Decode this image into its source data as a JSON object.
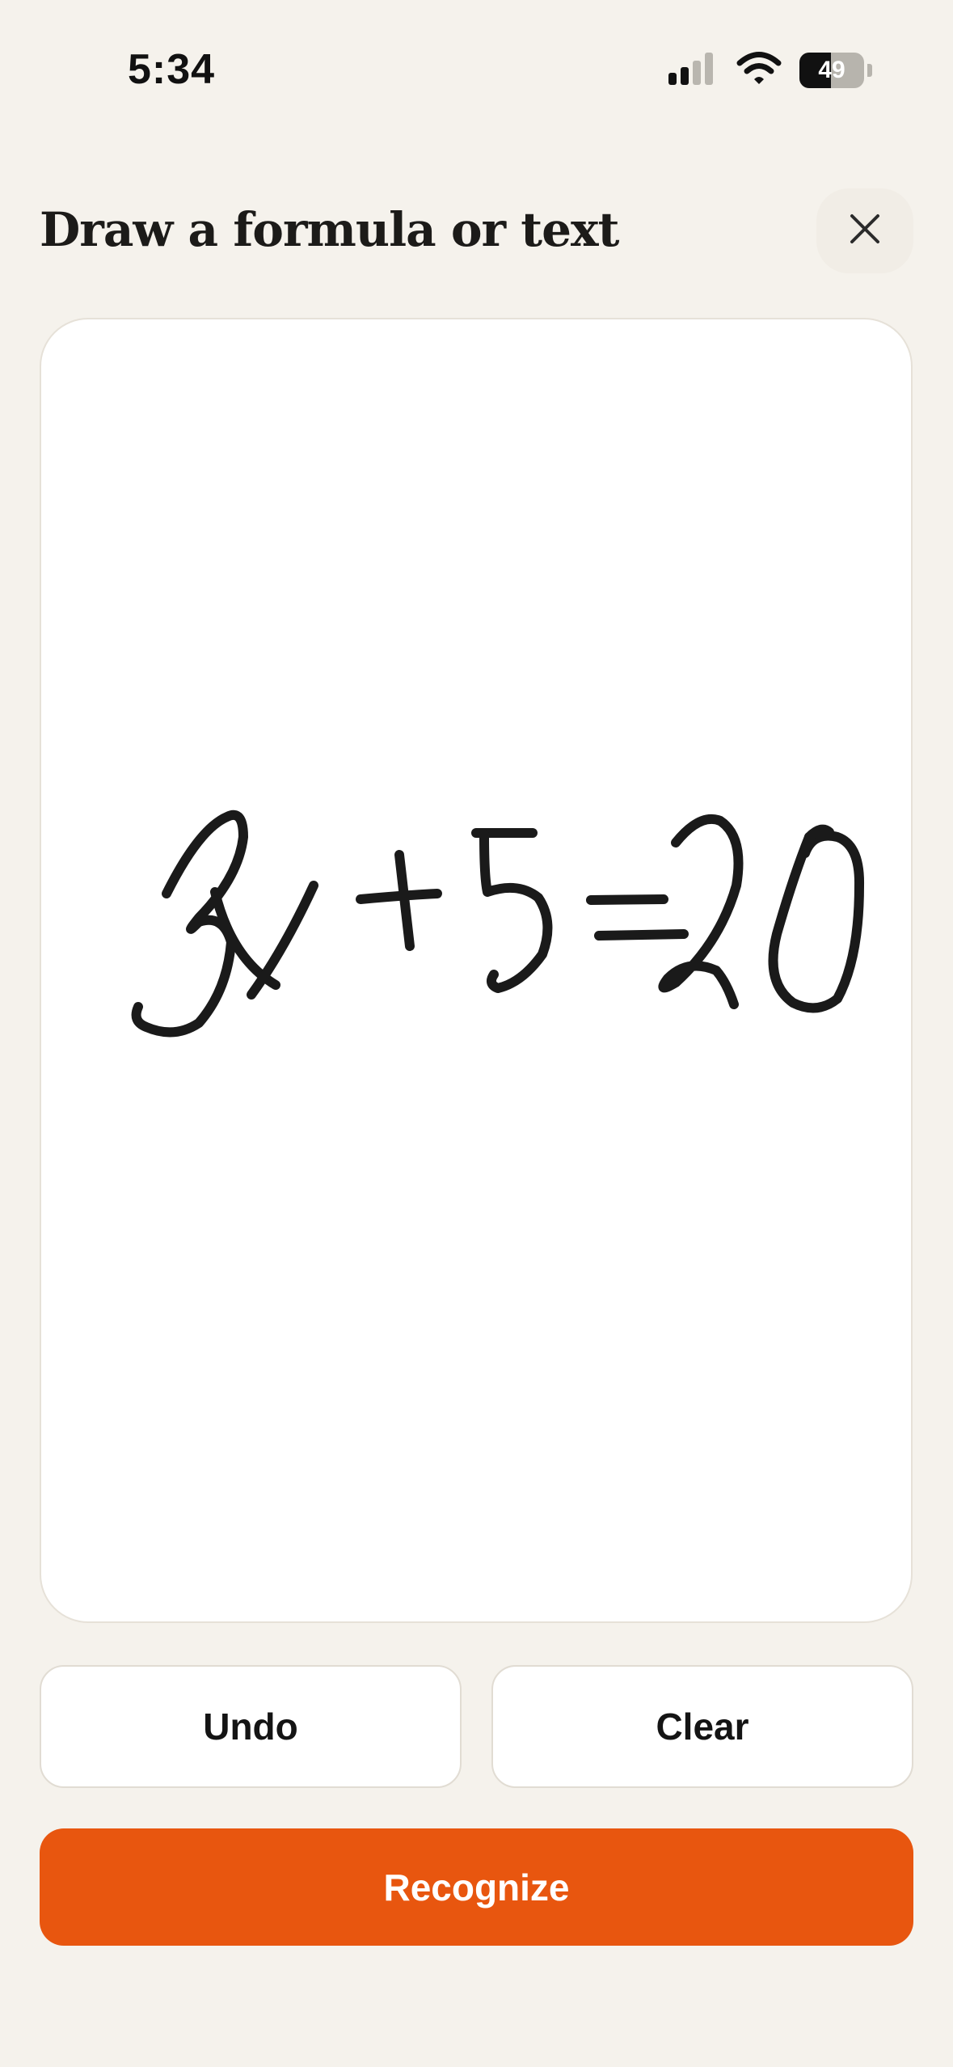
{
  "status_bar": {
    "time": "5:34",
    "battery_level": "49",
    "battery_fraction": 0.49,
    "icons": [
      "cellular-signal-icon",
      "wifi-icon",
      "battery-icon"
    ]
  },
  "header": {
    "title": "Draw a formula or text",
    "close_icon": "close-icon"
  },
  "canvas": {
    "handwritten_content": "3x+5=20"
  },
  "actions": {
    "undo_label": "Undo",
    "clear_label": "Clear",
    "recognize_label": "Recognize"
  },
  "colors": {
    "background": "#f5f2ec",
    "canvas": "#ffffff",
    "primary": "#e8560f",
    "ink": "#1a1a1a"
  }
}
